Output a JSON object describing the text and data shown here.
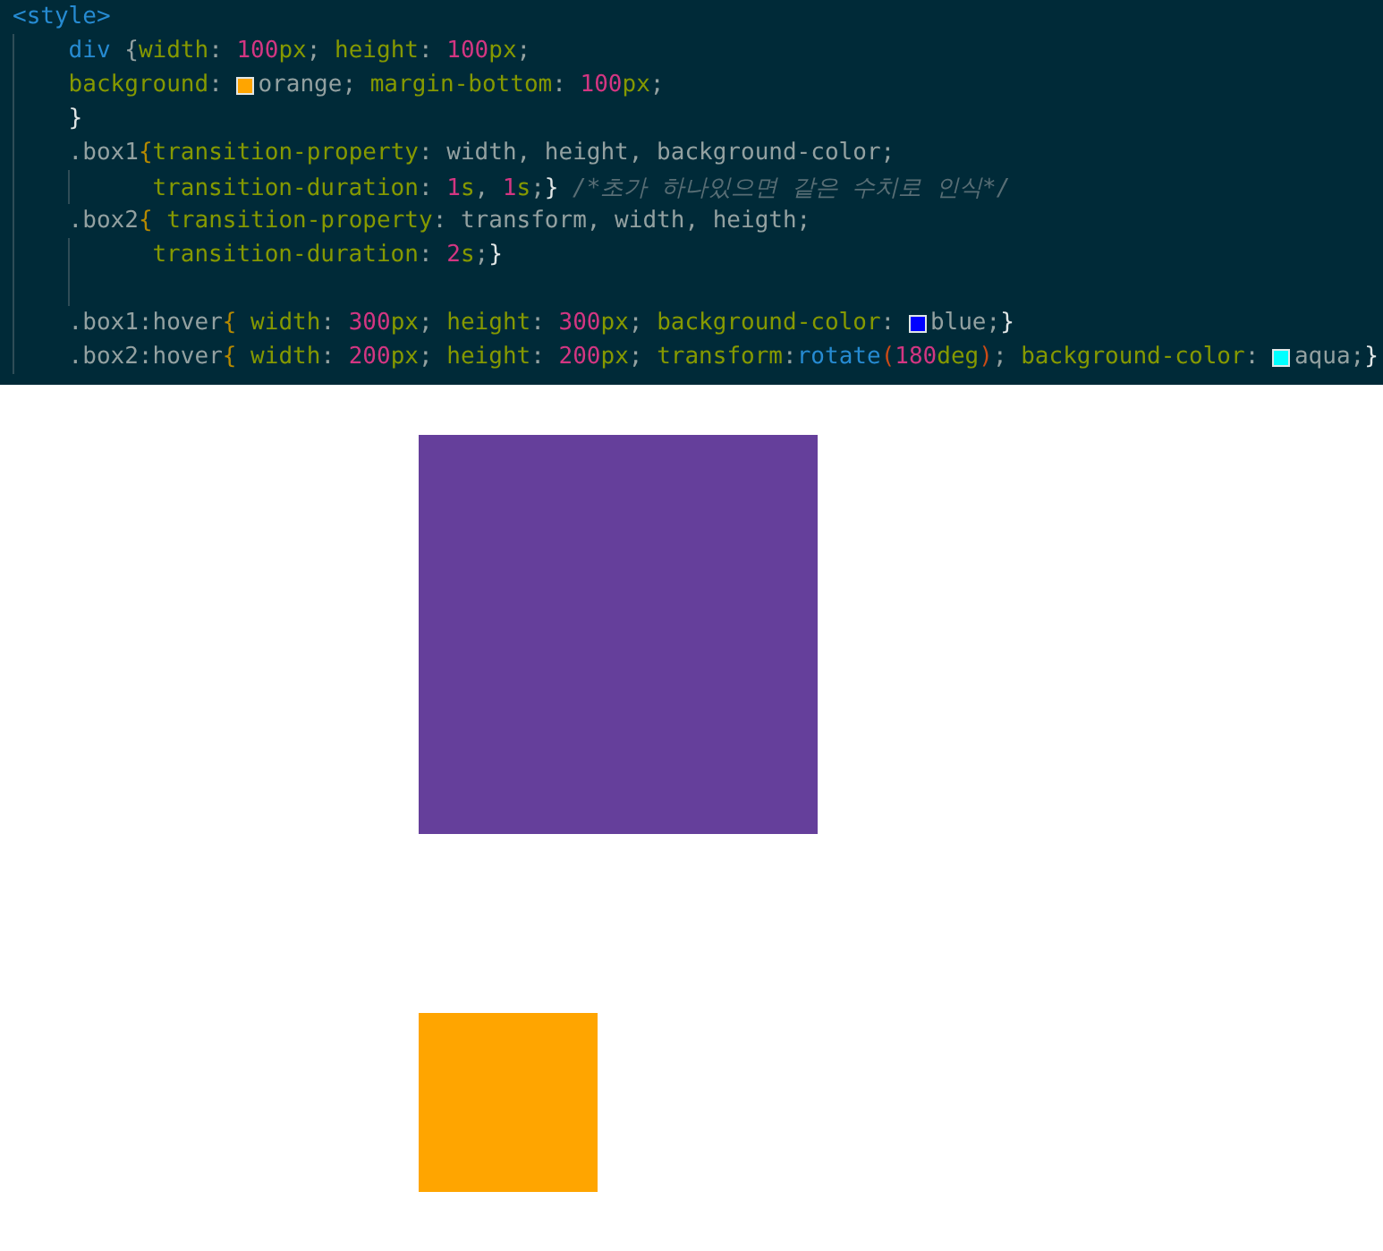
{
  "editor": {
    "lines": [
      {
        "kind": "open",
        "tokens": [
          {
            "kind": "tag",
            "text": "<style>"
          }
        ]
      },
      {
        "kind": "body",
        "tokens": [
          {
            "kind": "sel",
            "text": "div"
          },
          {
            "kind": "plain",
            "text": " {"
          },
          {
            "kind": "prop",
            "text": "width"
          },
          {
            "kind": "plain",
            "text": ": "
          },
          {
            "kind": "num",
            "text": "100"
          },
          {
            "kind": "unit",
            "text": "px"
          },
          {
            "kind": "plain",
            "text": "; "
          },
          {
            "kind": "prop",
            "text": "height"
          },
          {
            "kind": "plain",
            "text": ": "
          },
          {
            "kind": "num",
            "text": "100"
          },
          {
            "kind": "unit",
            "text": "px"
          },
          {
            "kind": "plain",
            "text": ";"
          }
        ]
      },
      {
        "kind": "body",
        "tokens": [
          {
            "kind": "prop",
            "text": "background"
          },
          {
            "kind": "plain",
            "text": ": "
          },
          {
            "kind": "swatch",
            "color": "#ffa500"
          },
          {
            "kind": "plain",
            "text": "orange; "
          },
          {
            "kind": "prop",
            "text": "margin-bottom"
          },
          {
            "kind": "plain",
            "text": ": "
          },
          {
            "kind": "num",
            "text": "100"
          },
          {
            "kind": "unit",
            "text": "px"
          },
          {
            "kind": "plain",
            "text": ";"
          }
        ]
      },
      {
        "kind": "body",
        "tokens": [
          {
            "kind": "close",
            "text": "}"
          }
        ]
      },
      {
        "kind": "body",
        "tokens": [
          {
            "kind": "plain",
            "text": ".box1"
          },
          {
            "kind": "brace",
            "text": "{"
          },
          {
            "kind": "prop",
            "text": "transition-property"
          },
          {
            "kind": "plain",
            "text": ": width, height, background-color;"
          }
        ]
      },
      {
        "kind": "wrap",
        "tokens": [
          {
            "kind": "prop",
            "text": "transition-duration"
          },
          {
            "kind": "plain",
            "text": ": "
          },
          {
            "kind": "num",
            "text": "1"
          },
          {
            "kind": "unit",
            "text": "s"
          },
          {
            "kind": "plain",
            "text": ", "
          },
          {
            "kind": "num",
            "text": "1"
          },
          {
            "kind": "unit",
            "text": "s"
          },
          {
            "kind": "plain",
            "text": ";"
          },
          {
            "kind": "close",
            "text": "}"
          },
          {
            "kind": "comment",
            "text": " /*초가 하나있으면 같은 수치로 인식*/"
          }
        ]
      },
      {
        "kind": "body",
        "tokens": [
          {
            "kind": "plain",
            "text": ".box2"
          },
          {
            "kind": "brace",
            "text": "{"
          },
          {
            "kind": "prop",
            "text": " transition-property"
          },
          {
            "kind": "plain",
            "text": ": transform, width, heigth;"
          }
        ]
      },
      {
        "kind": "wrap",
        "tokens": [
          {
            "kind": "prop",
            "text": "transition-duration"
          },
          {
            "kind": "plain",
            "text": ": "
          },
          {
            "kind": "num",
            "text": "2"
          },
          {
            "kind": "unit",
            "text": "s"
          },
          {
            "kind": "plain",
            "text": ";"
          },
          {
            "kind": "close",
            "text": "}"
          }
        ]
      },
      {
        "kind": "blank"
      },
      {
        "kind": "body",
        "tokens": [
          {
            "kind": "plain",
            "text": ".box1:hover"
          },
          {
            "kind": "brace",
            "text": "{"
          },
          {
            "kind": "prop",
            "text": " width"
          },
          {
            "kind": "plain",
            "text": ": "
          },
          {
            "kind": "num",
            "text": "300"
          },
          {
            "kind": "unit",
            "text": "px"
          },
          {
            "kind": "plain",
            "text": "; "
          },
          {
            "kind": "prop",
            "text": "height"
          },
          {
            "kind": "plain",
            "text": ": "
          },
          {
            "kind": "num",
            "text": "300"
          },
          {
            "kind": "unit",
            "text": "px"
          },
          {
            "kind": "plain",
            "text": "; "
          },
          {
            "kind": "prop",
            "text": "background-color"
          },
          {
            "kind": "plain",
            "text": ": "
          },
          {
            "kind": "swatch",
            "color": "#0000ff"
          },
          {
            "kind": "plain",
            "text": "blue;"
          },
          {
            "kind": "close",
            "text": "}"
          }
        ]
      },
      {
        "kind": "body",
        "tokens": [
          {
            "kind": "plain",
            "text": ".box2:hover"
          },
          {
            "kind": "brace",
            "text": "{"
          },
          {
            "kind": "prop",
            "text": " width"
          },
          {
            "kind": "plain",
            "text": ": "
          },
          {
            "kind": "num",
            "text": "200"
          },
          {
            "kind": "unit",
            "text": "px"
          },
          {
            "kind": "plain",
            "text": "; "
          },
          {
            "kind": "prop",
            "text": "height"
          },
          {
            "kind": "plain",
            "text": ": "
          },
          {
            "kind": "num",
            "text": "200"
          },
          {
            "kind": "unit",
            "text": "px"
          },
          {
            "kind": "plain",
            "text": "; "
          },
          {
            "kind": "prop",
            "text": "transform"
          },
          {
            "kind": "plain",
            "text": ":"
          },
          {
            "kind": "func",
            "text": "rotate"
          },
          {
            "kind": "paren",
            "text": "("
          },
          {
            "kind": "num",
            "text": "180"
          },
          {
            "kind": "unit",
            "text": "deg"
          },
          {
            "kind": "paren",
            "text": ")"
          },
          {
            "kind": "plain",
            "text": "; "
          },
          {
            "kind": "prop",
            "text": "background-color"
          },
          {
            "kind": "plain",
            "text": ": "
          },
          {
            "kind": "swatch",
            "color": "#00ffff"
          },
          {
            "kind": "plain",
            "text": "aqua;"
          },
          {
            "kind": "close",
            "text": "}"
          }
        ]
      }
    ]
  },
  "preview": {
    "boxes": [
      {
        "kind": "large",
        "color": "#653f9b"
      },
      {
        "kind": "small",
        "color": "#ffa500"
      }
    ]
  }
}
